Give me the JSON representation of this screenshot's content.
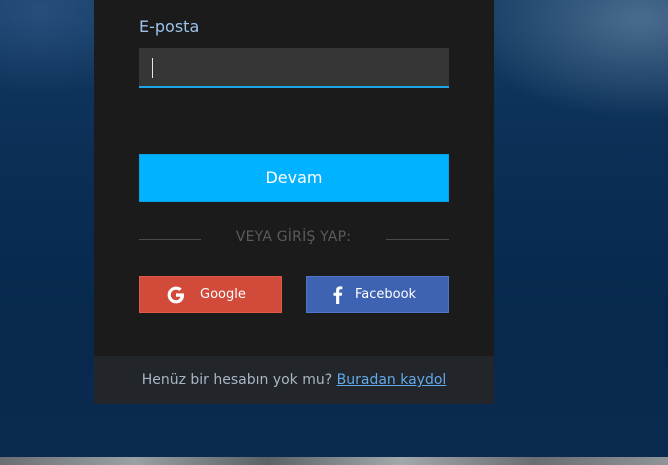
{
  "login": {
    "email_label": "E-posta",
    "email_value": "",
    "continue_label": "Devam",
    "divider_text": "VEYA GİRİŞ YAP:",
    "google_label": "Google",
    "facebook_label": "Facebook",
    "footer_prompt": "Henüz bir hesabın yok mu?",
    "signup_link": "Buradan kaydol"
  },
  "icons": {
    "google": "google-icon",
    "facebook": "facebook-icon"
  },
  "colors": {
    "accent": "#00b2ff",
    "field_underline": "#1aa6e8",
    "google": "#d24a3a",
    "facebook": "#3f63b3",
    "link": "#62a8ea",
    "label": "#9cc3ea"
  }
}
